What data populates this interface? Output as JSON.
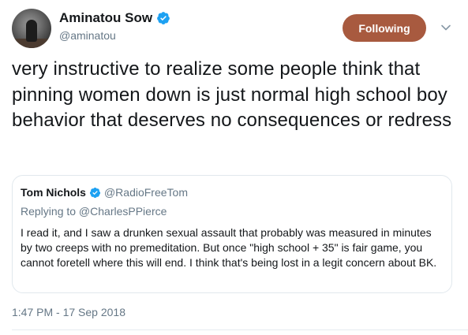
{
  "author": {
    "display_name": "Aminatou Sow",
    "handle": "@aminatou",
    "verified": true
  },
  "follow_button": {
    "label": "Following",
    "color": "#a85a3f"
  },
  "tweet": {
    "text": "very instructive to realize some people think that pinning women down is just normal high school boy behavior that deserves no consequences or redress",
    "timestamp": "1:47 PM - 17 Sep 2018"
  },
  "quoted_tweet": {
    "display_name": "Tom Nichols",
    "handle": "@RadioFreeTom",
    "verified": true,
    "reply_context": "Replying to @CharlesPPierce",
    "text": "I read it, and I saw a drunken sexual assault that probably was measured in minutes by two creeps with no premeditation. But once \"high school + 35\" is fair game, you cannot foretell where this will end. I think that's being lost in a legit concern about BK."
  },
  "icons": {
    "verified": "verified-badge-icon",
    "more": "chevron-down-icon"
  },
  "colors": {
    "verified": "#1da1f2",
    "secondary_text": "#657786"
  }
}
